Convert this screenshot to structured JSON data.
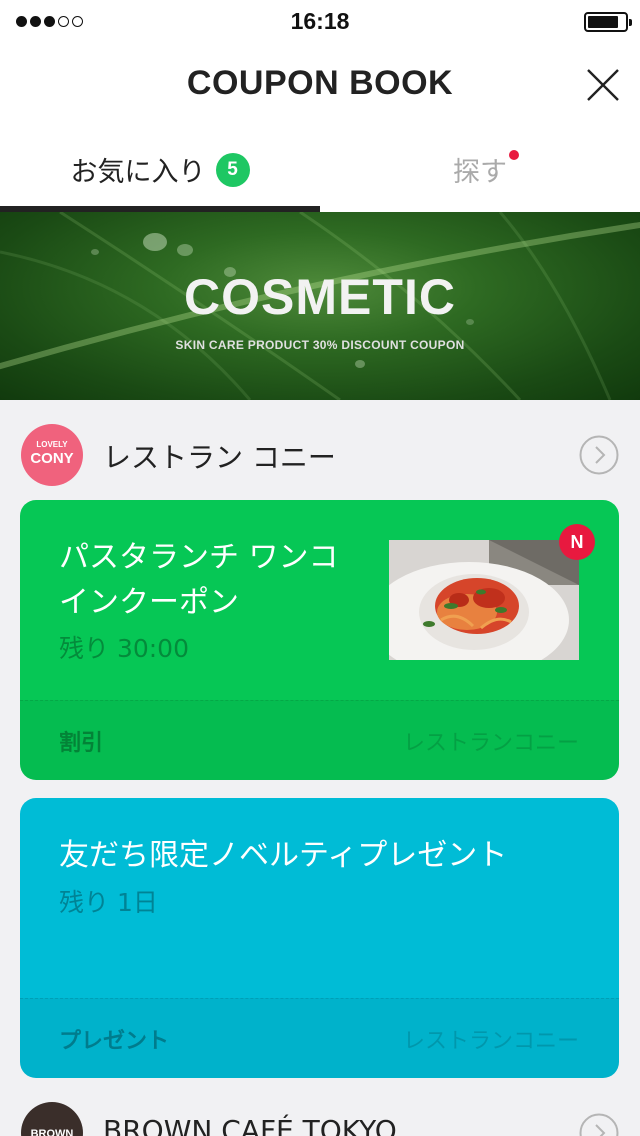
{
  "status_bar": {
    "time": "16:18"
  },
  "header": {
    "title": "COUPON BOOK"
  },
  "tabs": [
    {
      "label": "お気に入り",
      "badge": "5",
      "active": true
    },
    {
      "label": "探す",
      "has_new_dot": true
    }
  ],
  "banner": {
    "title": "COSMETIC",
    "subtitle": "SKIN CARE PRODUCT 30% DISCOUNT COUPON"
  },
  "stores": [
    {
      "logo_top": "LOVELY",
      "logo_main": "CONY",
      "name": "レストラン コニー",
      "coupons": [
        {
          "title": "パスタランチ ワンコインクーポン",
          "remaining": "残り 30:00",
          "type": "割引",
          "store": "レストランコニー",
          "new_badge": "N",
          "color": "#06c755"
        },
        {
          "title": "友だち限定ノベルティプレゼント",
          "remaining": "残り 1日",
          "type": "プレゼント",
          "store": "レストランコニー",
          "color": "#00bcd6"
        }
      ]
    },
    {
      "logo_main": "BROWN",
      "name": "BROWN CAFÉ TOKYO"
    }
  ],
  "colors": {
    "accent_green": "#1ec763",
    "alert_red": "#e8193f",
    "card_green": "#06c755",
    "card_blue": "#00bcd6"
  }
}
